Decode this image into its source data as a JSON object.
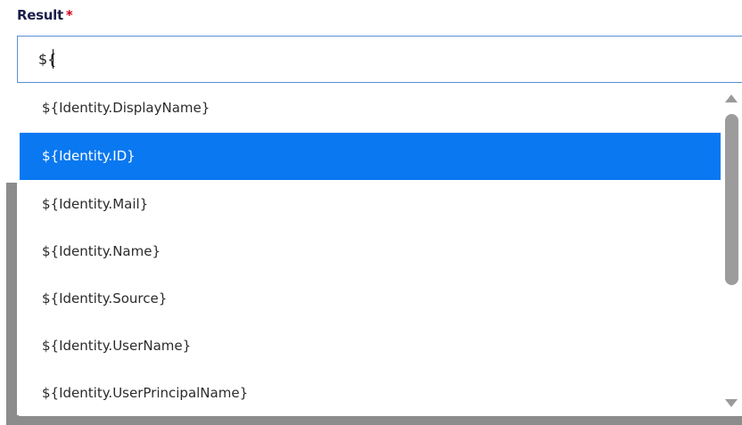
{
  "field": {
    "label": "Result",
    "required_marker": "*",
    "value": "${"
  },
  "dropdown": {
    "options": [
      "${Identity.DisplayName}",
      "${Identity.ID}",
      "${Identity.Mail}",
      "${Identity.Name}",
      "${Identity.Source}",
      "${Identity.UserName}",
      "${Identity.UserPrincipalName}"
    ],
    "selected_index": 1,
    "scroll_position_fraction": 0.0
  },
  "colors": {
    "label": "#1b1f4b",
    "required": "#d0021b",
    "selected_background": "#0a78f0",
    "selected_text": "#ffffff",
    "input_border": "#5b8fd6",
    "scrollbar_thumb": "#9c9c9c"
  }
}
